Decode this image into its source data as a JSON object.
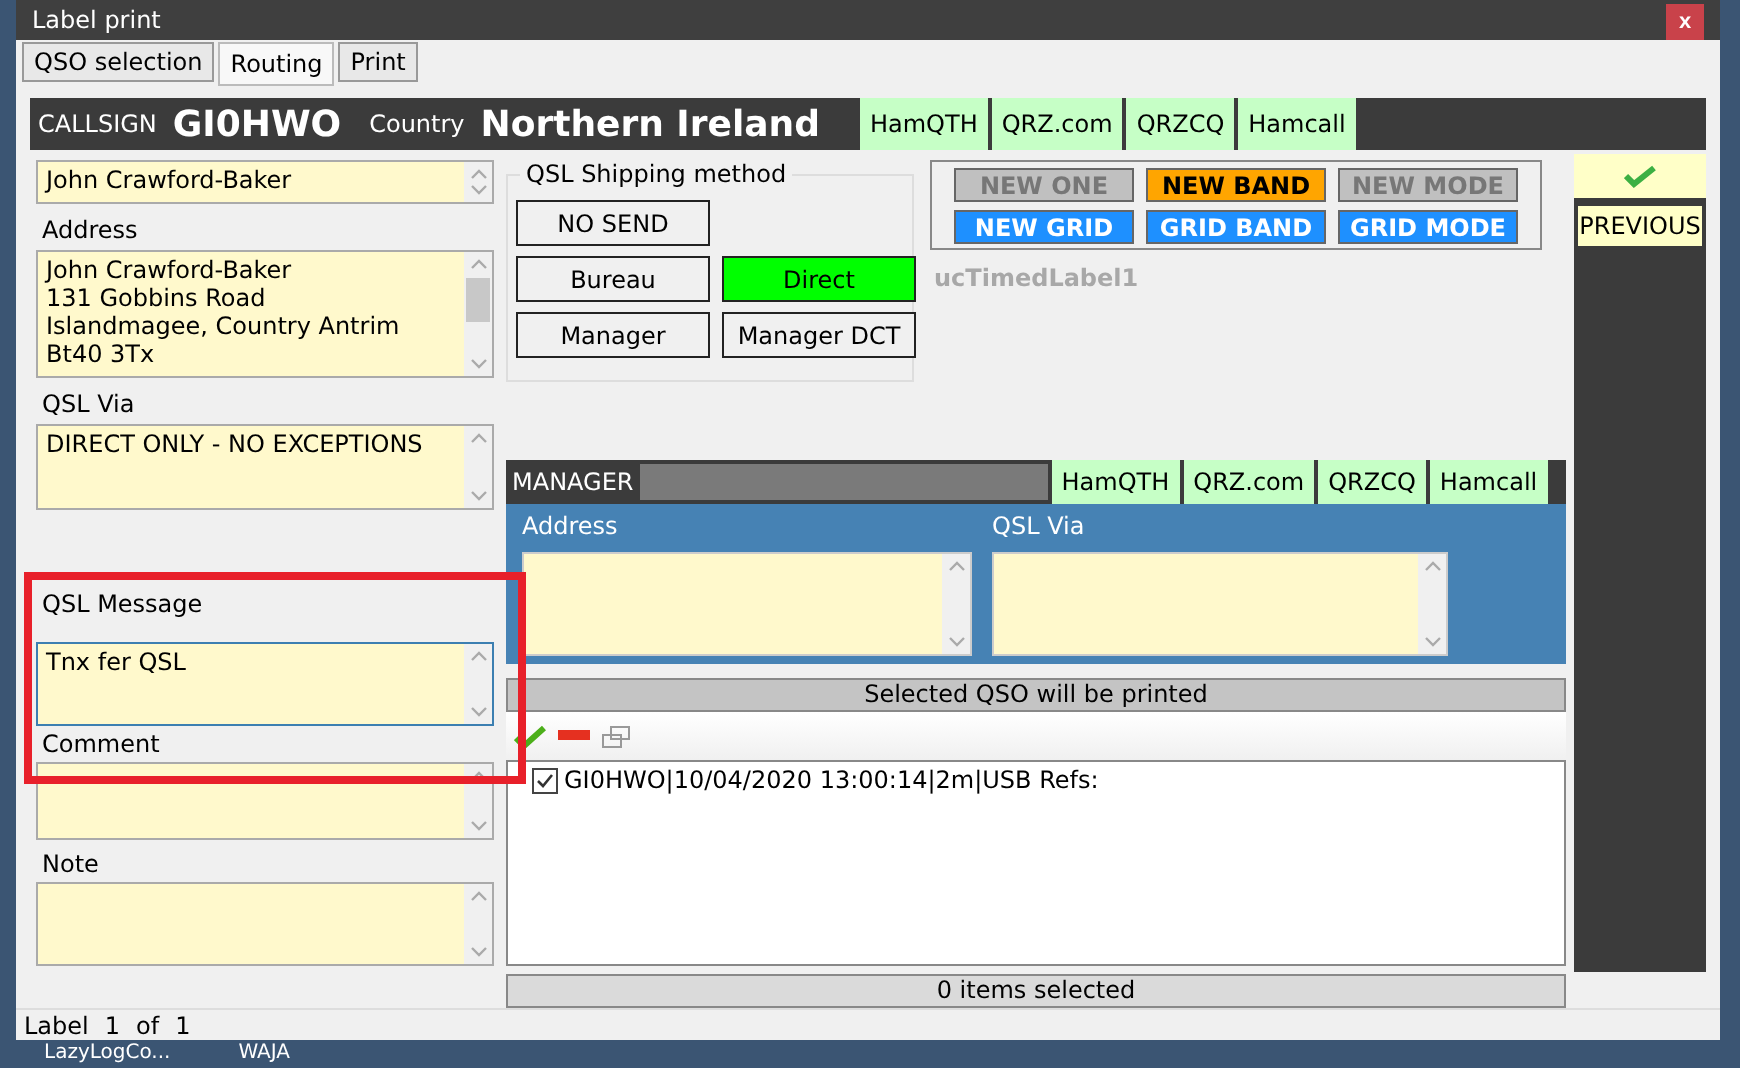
{
  "window": {
    "title": "Label print",
    "close": "x"
  },
  "tabs": [
    {
      "label": "QSO selection",
      "selected": false
    },
    {
      "label": "Routing",
      "selected": true
    },
    {
      "label": "Print",
      "selected": false
    }
  ],
  "header": {
    "callsign_label": "CALLSIGN",
    "callsign": "GI0HWO",
    "country_label": "Country",
    "country": "Northern Ireland",
    "links": [
      "HamQTH",
      "QRZ.com",
      "QRZCQ",
      "Hamcall"
    ]
  },
  "contact": {
    "name": "John Crawford-Baker",
    "address_label": "Address",
    "address": [
      "John Crawford-Baker",
      "131 Gobbins Road",
      "Islandmagee, Country Antrim",
      "Bt40 3Tx"
    ],
    "qsl_via_label": "QSL Via",
    "qsl_via": "DIRECT ONLY - NO EXCEPTIONS",
    "qsl_message_label": "QSL Message",
    "qsl_message": "Tnx fer QSL",
    "comment_label": "Comment",
    "note_label": "Note"
  },
  "shipping": {
    "title": "QSL Shipping method",
    "options": [
      {
        "label": "NO SEND",
        "selected": false
      },
      {
        "label": "Bureau",
        "selected": false
      },
      {
        "label": "Direct",
        "selected": true
      },
      {
        "label": "Manager",
        "selected": false
      },
      {
        "label": "Manager DCT",
        "selected": false
      }
    ]
  },
  "flags": [
    {
      "label": "NEW ONE",
      "on": false,
      "color": "#c0c0c0"
    },
    {
      "label": "NEW BAND",
      "on": true,
      "color": "#ffa500"
    },
    {
      "label": "NEW MODE",
      "on": false,
      "color": "#c0c0c0"
    },
    {
      "label": "NEW GRID",
      "on": true,
      "color": "#1e90ff"
    },
    {
      "label": "GRID BAND",
      "on": true,
      "color": "#1e90ff"
    },
    {
      "label": "GRID MODE",
      "on": true,
      "color": "#1e90ff"
    }
  ],
  "timed_label": "ucTimedLabel1",
  "nav": {
    "previous": "PREVIOUS"
  },
  "manager": {
    "label": "MANAGER",
    "links": [
      "HamQTH",
      "QRZ.com",
      "QRZCQ",
      "Hamcall"
    ],
    "address_label": "Address",
    "qsl_via_label": "QSL Via"
  },
  "print_list": {
    "header": "Selected QSO will be printed",
    "items": [
      {
        "text": "GI0HWO|10/04/2020 13:00:14|2m|USB Refs:",
        "checked": true
      }
    ],
    "footer": "0 items selected"
  },
  "status_bar": {
    "label": "Label",
    "index": "1",
    "of": "of",
    "total": "1"
  },
  "desktop": {
    "labels": [
      "LazyLogCo...",
      "WAJA"
    ]
  }
}
